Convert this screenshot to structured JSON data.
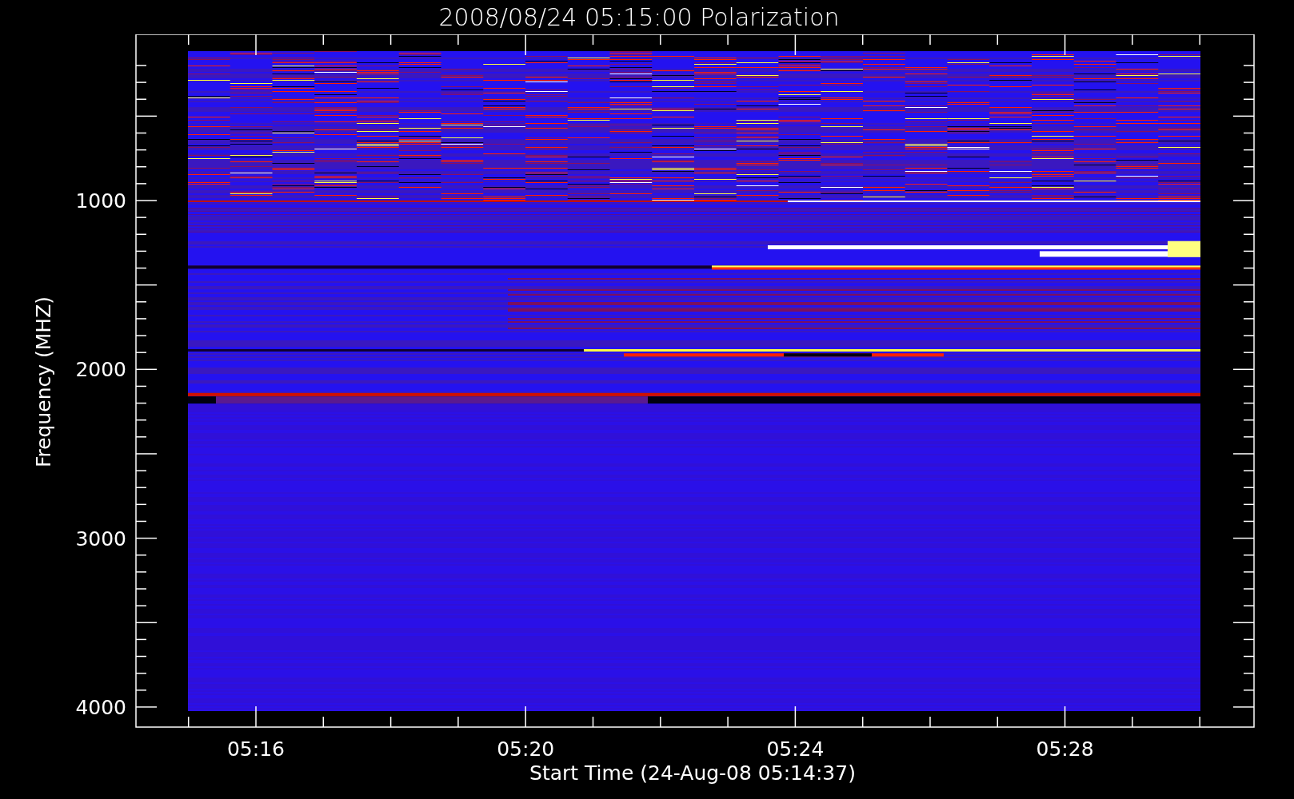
{
  "title": "2008/08/24 05:15:00 Polarization",
  "ylabel": "Frequency (MHZ)",
  "xlabel": "Start Time (24-Aug-08 05:14:37)",
  "yticks": [
    "1000",
    "2000",
    "3000",
    "4000"
  ],
  "xticks": [
    "05:16",
    "05:20",
    "05:24",
    "05:28"
  ]
}
